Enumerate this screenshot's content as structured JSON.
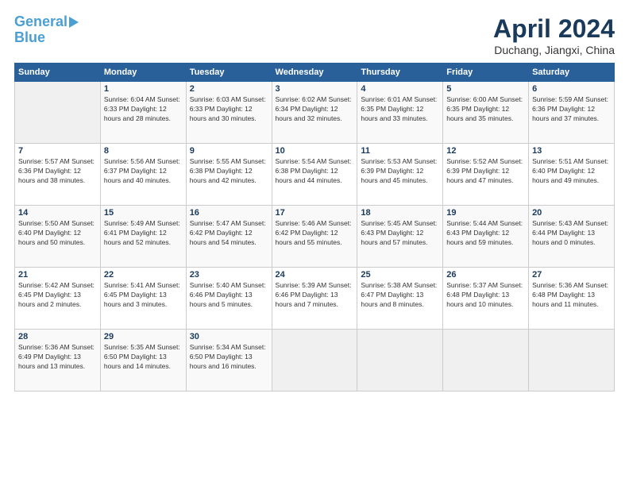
{
  "logo": {
    "line1": "General",
    "line2": "Blue"
  },
  "header": {
    "title": "April 2024",
    "location": "Duchang, Jiangxi, China"
  },
  "columns": [
    "Sunday",
    "Monday",
    "Tuesday",
    "Wednesday",
    "Thursday",
    "Friday",
    "Saturday"
  ],
  "weeks": [
    [
      {
        "day": "",
        "info": ""
      },
      {
        "day": "1",
        "info": "Sunrise: 6:04 AM\nSunset: 6:33 PM\nDaylight: 12 hours\nand 28 minutes."
      },
      {
        "day": "2",
        "info": "Sunrise: 6:03 AM\nSunset: 6:33 PM\nDaylight: 12 hours\nand 30 minutes."
      },
      {
        "day": "3",
        "info": "Sunrise: 6:02 AM\nSunset: 6:34 PM\nDaylight: 12 hours\nand 32 minutes."
      },
      {
        "day": "4",
        "info": "Sunrise: 6:01 AM\nSunset: 6:35 PM\nDaylight: 12 hours\nand 33 minutes."
      },
      {
        "day": "5",
        "info": "Sunrise: 6:00 AM\nSunset: 6:35 PM\nDaylight: 12 hours\nand 35 minutes."
      },
      {
        "day": "6",
        "info": "Sunrise: 5:59 AM\nSunset: 6:36 PM\nDaylight: 12 hours\nand 37 minutes."
      }
    ],
    [
      {
        "day": "7",
        "info": "Sunrise: 5:57 AM\nSunset: 6:36 PM\nDaylight: 12 hours\nand 38 minutes."
      },
      {
        "day": "8",
        "info": "Sunrise: 5:56 AM\nSunset: 6:37 PM\nDaylight: 12 hours\nand 40 minutes."
      },
      {
        "day": "9",
        "info": "Sunrise: 5:55 AM\nSunset: 6:38 PM\nDaylight: 12 hours\nand 42 minutes."
      },
      {
        "day": "10",
        "info": "Sunrise: 5:54 AM\nSunset: 6:38 PM\nDaylight: 12 hours\nand 44 minutes."
      },
      {
        "day": "11",
        "info": "Sunrise: 5:53 AM\nSunset: 6:39 PM\nDaylight: 12 hours\nand 45 minutes."
      },
      {
        "day": "12",
        "info": "Sunrise: 5:52 AM\nSunset: 6:39 PM\nDaylight: 12 hours\nand 47 minutes."
      },
      {
        "day": "13",
        "info": "Sunrise: 5:51 AM\nSunset: 6:40 PM\nDaylight: 12 hours\nand 49 minutes."
      }
    ],
    [
      {
        "day": "14",
        "info": "Sunrise: 5:50 AM\nSunset: 6:40 PM\nDaylight: 12 hours\nand 50 minutes."
      },
      {
        "day": "15",
        "info": "Sunrise: 5:49 AM\nSunset: 6:41 PM\nDaylight: 12 hours\nand 52 minutes."
      },
      {
        "day": "16",
        "info": "Sunrise: 5:47 AM\nSunset: 6:42 PM\nDaylight: 12 hours\nand 54 minutes."
      },
      {
        "day": "17",
        "info": "Sunrise: 5:46 AM\nSunset: 6:42 PM\nDaylight: 12 hours\nand 55 minutes."
      },
      {
        "day": "18",
        "info": "Sunrise: 5:45 AM\nSunset: 6:43 PM\nDaylight: 12 hours\nand 57 minutes."
      },
      {
        "day": "19",
        "info": "Sunrise: 5:44 AM\nSunset: 6:43 PM\nDaylight: 12 hours\nand 59 minutes."
      },
      {
        "day": "20",
        "info": "Sunrise: 5:43 AM\nSunset: 6:44 PM\nDaylight: 13 hours\nand 0 minutes."
      }
    ],
    [
      {
        "day": "21",
        "info": "Sunrise: 5:42 AM\nSunset: 6:45 PM\nDaylight: 13 hours\nand 2 minutes."
      },
      {
        "day": "22",
        "info": "Sunrise: 5:41 AM\nSunset: 6:45 PM\nDaylight: 13 hours\nand 3 minutes."
      },
      {
        "day": "23",
        "info": "Sunrise: 5:40 AM\nSunset: 6:46 PM\nDaylight: 13 hours\nand 5 minutes."
      },
      {
        "day": "24",
        "info": "Sunrise: 5:39 AM\nSunset: 6:46 PM\nDaylight: 13 hours\nand 7 minutes."
      },
      {
        "day": "25",
        "info": "Sunrise: 5:38 AM\nSunset: 6:47 PM\nDaylight: 13 hours\nand 8 minutes."
      },
      {
        "day": "26",
        "info": "Sunrise: 5:37 AM\nSunset: 6:48 PM\nDaylight: 13 hours\nand 10 minutes."
      },
      {
        "day": "27",
        "info": "Sunrise: 5:36 AM\nSunset: 6:48 PM\nDaylight: 13 hours\nand 11 minutes."
      }
    ],
    [
      {
        "day": "28",
        "info": "Sunrise: 5:36 AM\nSunset: 6:49 PM\nDaylight: 13 hours\nand 13 minutes."
      },
      {
        "day": "29",
        "info": "Sunrise: 5:35 AM\nSunset: 6:50 PM\nDaylight: 13 hours\nand 14 minutes."
      },
      {
        "day": "30",
        "info": "Sunrise: 5:34 AM\nSunset: 6:50 PM\nDaylight: 13 hours\nand 16 minutes."
      },
      {
        "day": "",
        "info": ""
      },
      {
        "day": "",
        "info": ""
      },
      {
        "day": "",
        "info": ""
      },
      {
        "day": "",
        "info": ""
      }
    ]
  ]
}
